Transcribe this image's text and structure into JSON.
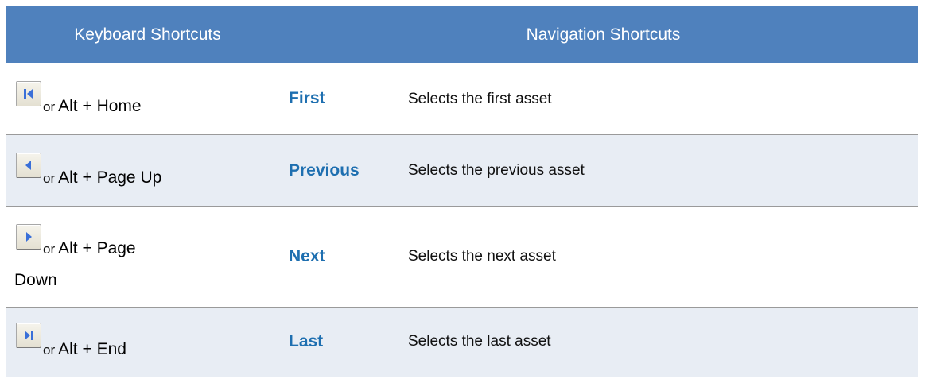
{
  "header": {
    "keyboard": "Keyboard Shortcuts",
    "navigation": "Navigation Shortcuts"
  },
  "rows": [
    {
      "icon": "first-icon",
      "or": "or",
      "keys": "Alt + Home",
      "keys_cont": "",
      "name": "First",
      "description": "Selects the first asset"
    },
    {
      "icon": "previous-icon",
      "or": "or",
      "keys": "Alt + Page Up",
      "keys_cont": "",
      "name": "Previous",
      "description": "Selects the previous asset"
    },
    {
      "icon": "next-icon",
      "or": "or",
      "keys": "Alt + Page",
      "keys_cont": "Down",
      "name": "Next",
      "description": "Selects the next asset"
    },
    {
      "icon": "last-icon",
      "or": "or",
      "keys": "Alt + End",
      "keys_cont": "",
      "name": "Last",
      "description": "Selects the last asset"
    }
  ],
  "colors": {
    "header_bg": "#4f81bd",
    "header_text": "#ffffff",
    "alt_row_bg": "#e8edf4",
    "link_text": "#1e6fb0",
    "icon_arrow": "#3a6fd8"
  }
}
